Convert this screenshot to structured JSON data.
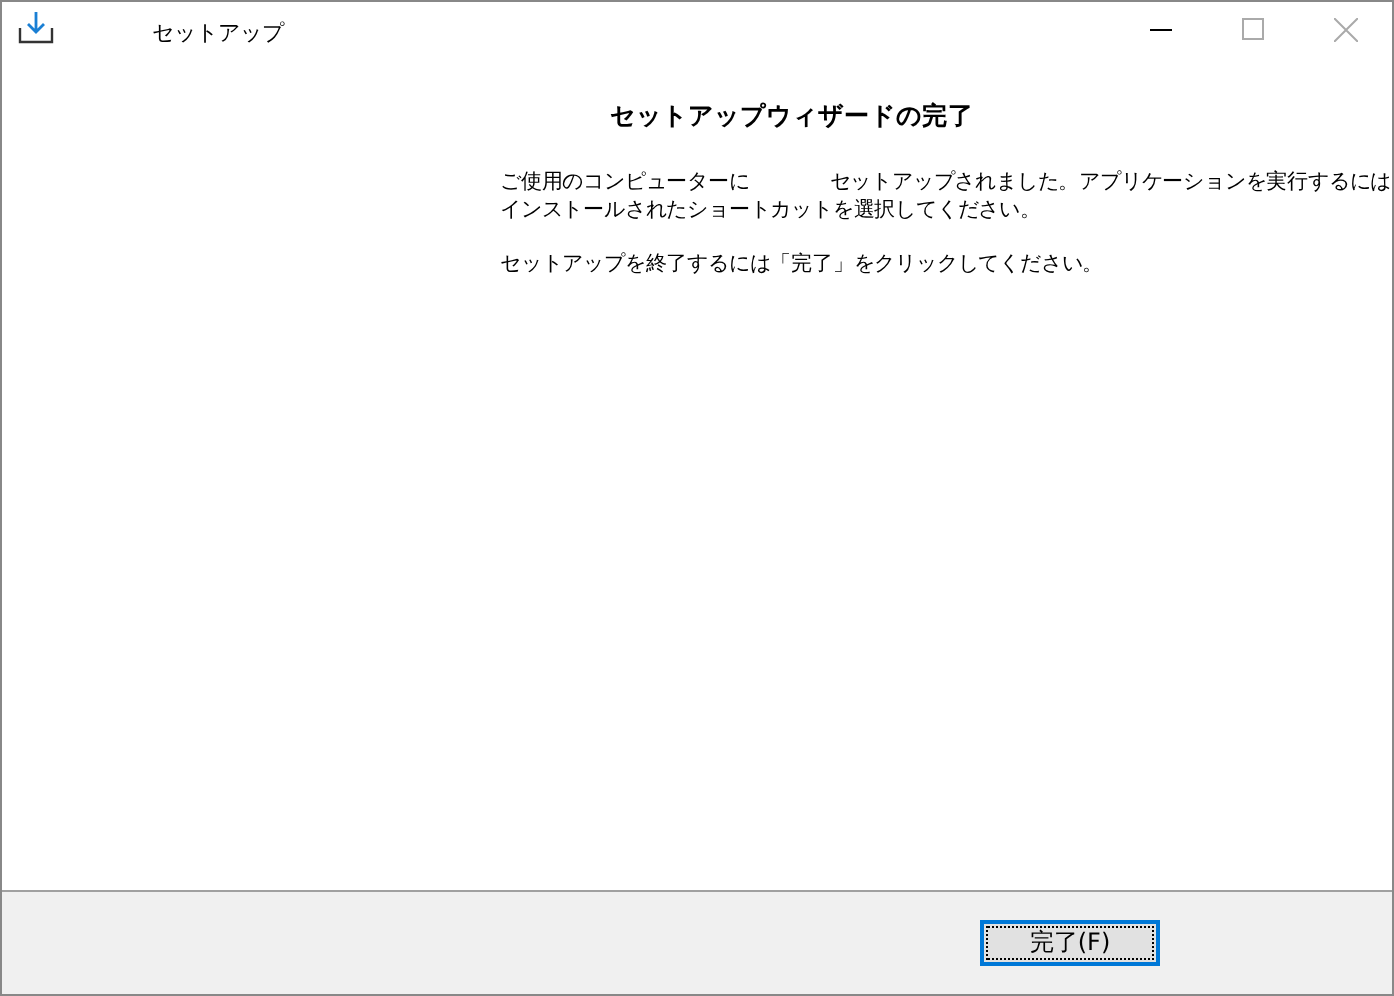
{
  "window": {
    "title": "セットアップ"
  },
  "heading": "セットアップウィザードの完了",
  "paragraphs": [
    {
      "lines": [
        [
          "ご使用のコンピューターに",
          "セットアップされました。アプリケーションを実行するには"
        ],
        [
          "インストールされたショートカットを選択してください。"
        ]
      ]
    },
    {
      "lines": [
        [
          "セットアップを終了するには「完了」をクリックしてください。"
        ]
      ]
    }
  ],
  "buttons": [
    {
      "label": "完了(F)",
      "focused": true
    }
  ]
}
